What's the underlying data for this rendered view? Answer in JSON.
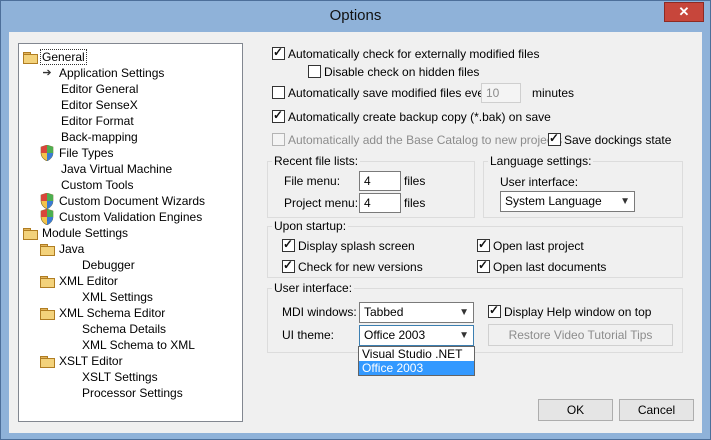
{
  "window": {
    "title": "Options",
    "close_label": "✕"
  },
  "tree": [
    {
      "label": "General",
      "icon": "folder",
      "level": 0,
      "selected": true
    },
    {
      "label": "Application Settings",
      "icon": "arrow",
      "level": 1
    },
    {
      "label": "Editor General",
      "icon": "none",
      "level": 1
    },
    {
      "label": "Editor SenseX",
      "icon": "none",
      "level": 1
    },
    {
      "label": "Editor Format",
      "icon": "none",
      "level": 1
    },
    {
      "label": "Back-mapping",
      "icon": "none",
      "level": 1
    },
    {
      "label": "File Types",
      "icon": "shield",
      "level": 1
    },
    {
      "label": "Java Virtual Machine",
      "icon": "none",
      "level": 1
    },
    {
      "label": "Custom Tools",
      "icon": "none",
      "level": 1
    },
    {
      "label": "Custom Document Wizards",
      "icon": "shield",
      "level": 1
    },
    {
      "label": "Custom Validation Engines",
      "icon": "shield",
      "level": 1
    },
    {
      "label": "Module Settings",
      "icon": "folder",
      "level": 0
    },
    {
      "label": "Java",
      "icon": "folder",
      "level": 1
    },
    {
      "label": "Debugger",
      "icon": "none",
      "level": 2
    },
    {
      "label": "XML Editor",
      "icon": "folder",
      "level": 1
    },
    {
      "label": "XML Settings",
      "icon": "none",
      "level": 2
    },
    {
      "label": "XML Schema Editor",
      "icon": "folder",
      "level": 1
    },
    {
      "label": "Schema Details",
      "icon": "none",
      "level": 2
    },
    {
      "label": "XML Schema to XML",
      "icon": "none",
      "level": 2
    },
    {
      "label": "XSLT Editor",
      "icon": "folder",
      "level": 1
    },
    {
      "label": "XSLT Settings",
      "icon": "none",
      "level": 2
    },
    {
      "label": "Processor Settings",
      "icon": "none",
      "level": 2
    }
  ],
  "general": {
    "auto_check_label": "Automatically check for externally modified files",
    "auto_check": true,
    "disable_hidden_label": "Disable check on hidden files",
    "disable_hidden": false,
    "auto_save_label": "Automatically save modified files every",
    "auto_save": false,
    "auto_save_minutes": "10",
    "minutes_label": "minutes",
    "backup_label": "Automatically create backup copy (*.bak) on save",
    "backup": true,
    "base_catalog_label": "Automatically add the Base Catalog to new projects",
    "base_catalog": false,
    "save_dockings_label": "Save dockings state",
    "save_dockings": true
  },
  "recent": {
    "title": "Recent file lists:",
    "file_menu_label": "File menu:",
    "file_menu_value": "4",
    "project_menu_label": "Project menu:",
    "project_menu_value": "4",
    "files_label": "files"
  },
  "language": {
    "title": "Language settings:",
    "ui_label": "User interface:",
    "value": "System Language"
  },
  "startup": {
    "title": "Upon startup:",
    "splash_label": "Display splash screen",
    "splash": true,
    "check_versions_label": "Check for new versions",
    "check_versions": true,
    "open_project_label": "Open last project",
    "open_project": true,
    "open_docs_label": "Open last documents",
    "open_docs": true
  },
  "ui": {
    "title": "User interface:",
    "mdi_label": "MDI windows:",
    "mdi_value": "Tabbed",
    "help_label": "Display Help window on top",
    "help": true,
    "theme_label": "UI theme:",
    "theme_value": "Office 2003",
    "restore_label": "Restore Video Tutorial Tips",
    "theme_options": [
      "Visual Studio .NET",
      "Office 2003"
    ],
    "theme_highlighted": 1
  },
  "buttons": {
    "ok": "OK",
    "cancel": "Cancel"
  }
}
